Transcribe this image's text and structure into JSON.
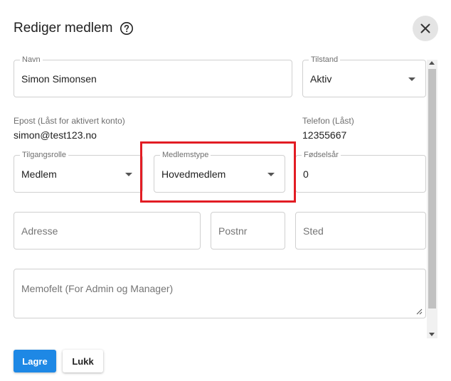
{
  "dialog": {
    "title": "Rediger medlem",
    "help_icon": "help-circle-icon",
    "close_icon": "close-icon"
  },
  "fields": {
    "name": {
      "label": "Navn",
      "value": "Simon Simonsen"
    },
    "status": {
      "label": "Tilstand",
      "value": "Aktiv"
    },
    "email": {
      "label": "Epost (Låst for aktivert konto)",
      "value": "simon@test123.no"
    },
    "phone": {
      "label": "Telefon (Låst)",
      "value": "12355667"
    },
    "access_role": {
      "label": "Tilgangsrolle",
      "value": "Medlem"
    },
    "member_type": {
      "label": "Medlemstype",
      "value": "Hovedmedlem"
    },
    "birth_year": {
      "label": "Fødselsår",
      "value": "0"
    },
    "address": {
      "placeholder": "Adresse"
    },
    "postal_code": {
      "placeholder": "Postnr"
    },
    "city": {
      "placeholder": "Sted"
    },
    "memo": {
      "placeholder": "Memofelt (For Admin og Manager)"
    }
  },
  "actions": {
    "save_label": "Lagre",
    "close_label": "Lukk"
  },
  "colors": {
    "primary": "#1e88e5",
    "highlight": "#e21d24"
  }
}
